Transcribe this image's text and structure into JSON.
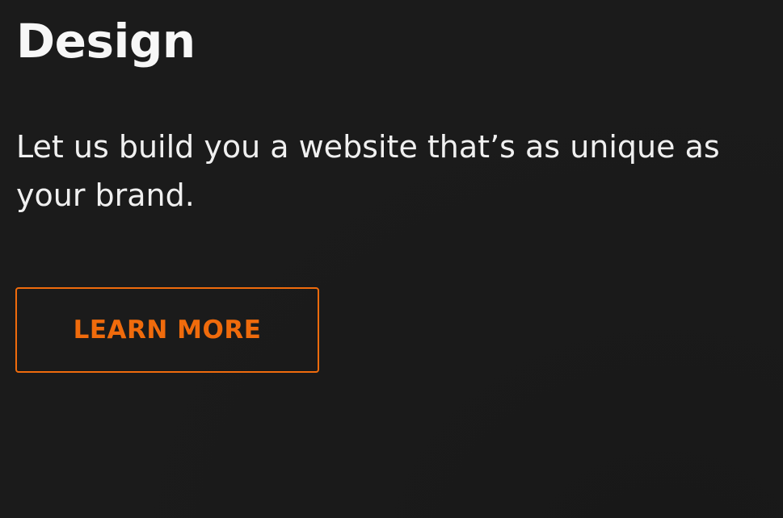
{
  "hero": {
    "title": "Design",
    "description_line1": "Let us build you a website that’s as unique as",
    "description_line2": "your brand.",
    "cta_label": "LEARN MORE"
  },
  "colors": {
    "background": "#1b1b1b",
    "heading": "#f7f7f7",
    "body_text": "#f0f0f0",
    "accent": "#f06b0c"
  }
}
